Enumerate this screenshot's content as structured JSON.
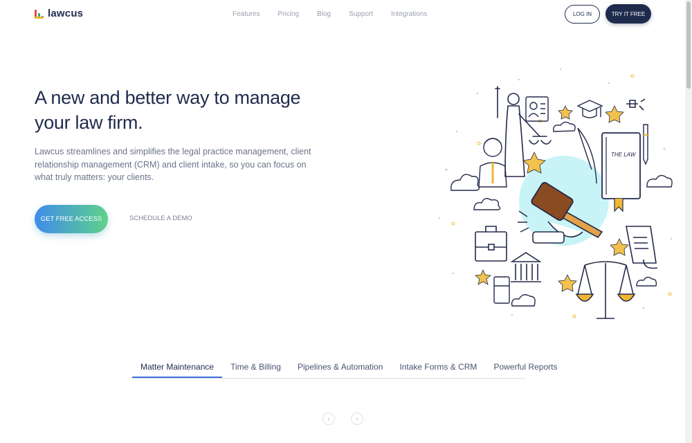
{
  "brand": {
    "name": "lawcus"
  },
  "nav": {
    "links": [
      "Features",
      "Pricing",
      "Blog",
      "Support",
      "Integrations"
    ],
    "login_label": "LOG IN",
    "try_label": "TRY IT FREE"
  },
  "hero": {
    "title": "A new and better way to manage your law firm.",
    "description": "Lawcus streamlines and simplifies the legal practice management, client relationship management (CRM) and client intake, so you can focus on what truly matters: your clients.",
    "primary_cta": "GET FREE ACCESS",
    "secondary_cta": "SCHEDULE A DEMO",
    "illustration_book_label": "THE LAW"
  },
  "tabs": {
    "items": [
      "Matter Maintenance",
      "Time & Billing",
      "Pipelines & Automation",
      "Intake Forms & CRM",
      "Powerful Reports"
    ],
    "active_index": 0
  },
  "carousel": {
    "prev_icon": "‹",
    "next_icon": "›"
  },
  "colors": {
    "navy": "#1f2b4d",
    "gradient_start": "#3f8dea",
    "gradient_end": "#5fd18a",
    "accent_tab": "#3f6fe0",
    "star": "#f2c14e",
    "gavel": "#8a4a22",
    "bubble": "#c9f4f7"
  }
}
